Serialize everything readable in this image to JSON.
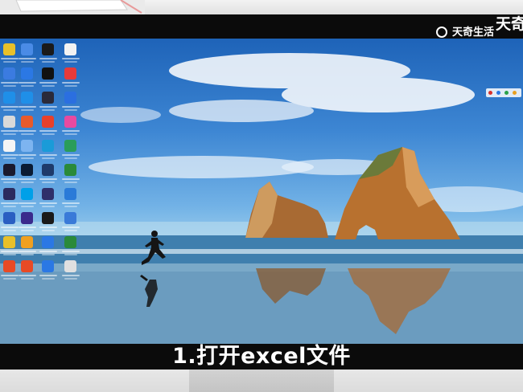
{
  "caption": "1.打开excel文件",
  "watermark": {
    "logo_text": "天奇生活",
    "brand_fragment": "天奇"
  },
  "desktop": {
    "icon_columns": [
      [
        "#e8c02a",
        "#3b7be0",
        "#1f8fe8",
        "#d9d9d9",
        "#f5f5f5",
        "#1a1a2e",
        "#2b2b5e",
        "#2a5fc2",
        "#e8c02a",
        "#e84a25"
      ],
      [
        "#4a8be6",
        "#2b78e4",
        "#1f8fe8",
        "#e85a2b",
        "#7db4f0",
        "#0a1b33",
        "#00a0e8",
        "#3a2a8c",
        "#f0a020",
        "#e84a25"
      ],
      [
        "#1a1a1a",
        "#111111",
        "#2a2a3a",
        "#e8402a",
        "#1a9bd8",
        "#1e3a6a",
        "#2f2f6a",
        "#1a1a1a",
        "#2b78e4",
        "#2b78e4"
      ],
      [
        "#f2f2f2",
        "#e83a3a",
        "#2b6fe0",
        "#e84aa0",
        "#2a9d5a",
        "#2a8a3a",
        "#2a7ad8",
        "#3a7ad8",
        "#2a8a3a",
        "#e0e0e0"
      ]
    ]
  },
  "colors": {
    "bezel": "#0b0b0b",
    "caption_text": "#ffffff",
    "sky_top": "#1e63b8",
    "sea": "#7fb0cf"
  }
}
